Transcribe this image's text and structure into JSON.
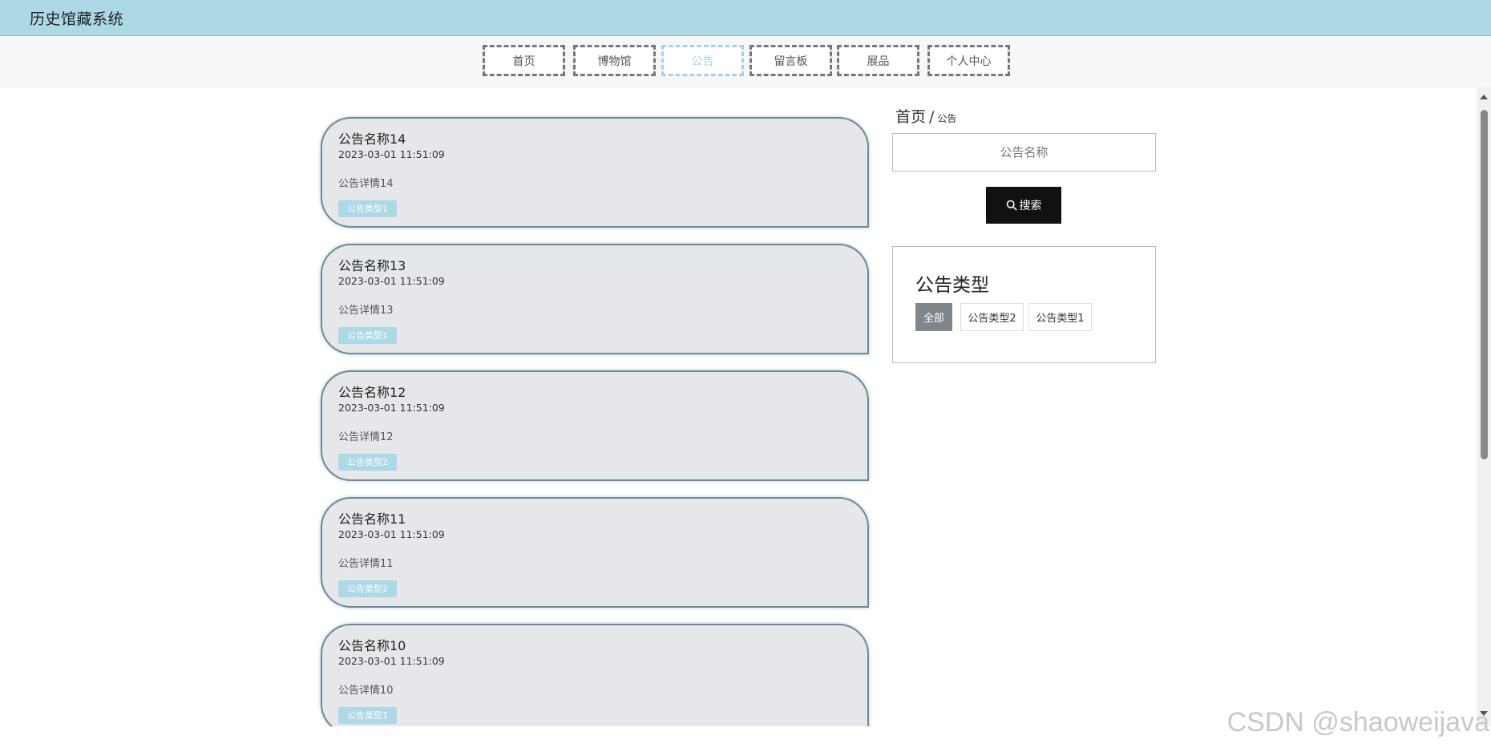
{
  "header": {
    "title": "历史馆藏系统"
  },
  "nav": [
    {
      "label": "首页",
      "active": false
    },
    {
      "label": "博物馆",
      "active": false
    },
    {
      "label": "公告",
      "active": true
    },
    {
      "label": "留言板",
      "active": false
    },
    {
      "label": "展品",
      "active": false
    },
    {
      "label": "个人中心",
      "active": false
    }
  ],
  "notices": [
    {
      "title": "公告名称14",
      "time": "2023-03-01 11:51:09",
      "desc": "公告详情14",
      "type": "公告类型1"
    },
    {
      "title": "公告名称13",
      "time": "2023-03-01 11:51:09",
      "desc": "公告详情13",
      "type": "公告类型1"
    },
    {
      "title": "公告名称12",
      "time": "2023-03-01 11:51:09",
      "desc": "公告详情12",
      "type": "公告类型2"
    },
    {
      "title": "公告名称11",
      "time": "2023-03-01 11:51:09",
      "desc": "公告详情11",
      "type": "公告类型2"
    },
    {
      "title": "公告名称10",
      "time": "2023-03-01 11:51:09",
      "desc": "公告详情10",
      "type": "公告类型1"
    }
  ],
  "sidebar": {
    "breadcrumb": {
      "home": "首页",
      "separator": "/",
      "current": "公告"
    },
    "search": {
      "placeholder": "公告名称",
      "button_label": "搜索"
    },
    "types": {
      "heading": "公告类型",
      "options": [
        {
          "label": "全部",
          "active": true
        },
        {
          "label": "公告类型2",
          "active": false
        },
        {
          "label": "公告类型1",
          "active": false
        }
      ]
    }
  },
  "watermark": "CSDN @shaoweijava",
  "colors": {
    "header_bg": "#add8e6",
    "accent": "#add8e6",
    "search_button": "#111111",
    "active_type": "#7f878c"
  }
}
